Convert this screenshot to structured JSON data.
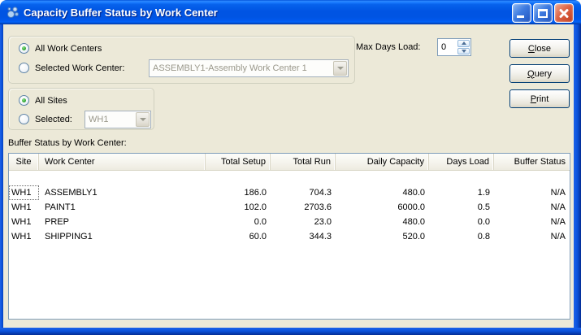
{
  "window": {
    "title": "Capacity Buffer Status by Work Center"
  },
  "colors": {
    "titlebar_blue": "#0054E3",
    "dialog_beige": "#ECE9D8",
    "field_border_blue": "#7F9DB9",
    "radio_green": "#3CB03C",
    "close_button_red": "#C13C1C"
  },
  "work_center_group": {
    "all_label": "All Work Centers",
    "all_selected": true,
    "selected_label": "Selected Work Center:",
    "selected_value": "ASSEMBLY1-Assembly Work Center 1",
    "combo_disabled": true
  },
  "max_days_load": {
    "label": "Max Days Load:",
    "value": "0"
  },
  "buttons": {
    "close": "Close",
    "query": "Query",
    "print": "Print"
  },
  "site_group": {
    "all_label": "All Sites",
    "all_selected": true,
    "selected_label": "Selected:",
    "selected_value": "WH1",
    "combo_disabled": true
  },
  "table": {
    "caption": "Buffer Status by Work Center:",
    "columns": [
      "Site",
      "Work Center",
      "Total Setup",
      "Total Run",
      "Daily Capacity",
      "Days Load",
      "Buffer Status"
    ],
    "rows": [
      {
        "site": "WH1",
        "work_center": "ASSEMBLY1",
        "total_setup": "186.0",
        "total_run": "704.3",
        "daily_capacity": "480.0",
        "days_load": "1.9",
        "buffer_status": "N/A"
      },
      {
        "site": "WH1",
        "work_center": "PAINT1",
        "total_setup": "102.0",
        "total_run": "2703.6",
        "daily_capacity": "6000.0",
        "days_load": "0.5",
        "buffer_status": "N/A"
      },
      {
        "site": "WH1",
        "work_center": "PREP",
        "total_setup": "0.0",
        "total_run": "23.0",
        "daily_capacity": "480.0",
        "days_load": "0.0",
        "buffer_status": "N/A"
      },
      {
        "site": "WH1",
        "work_center": "SHIPPING1",
        "total_setup": "60.0",
        "total_run": "344.3",
        "daily_capacity": "520.0",
        "days_load": "0.8",
        "buffer_status": "N/A"
      }
    ]
  }
}
